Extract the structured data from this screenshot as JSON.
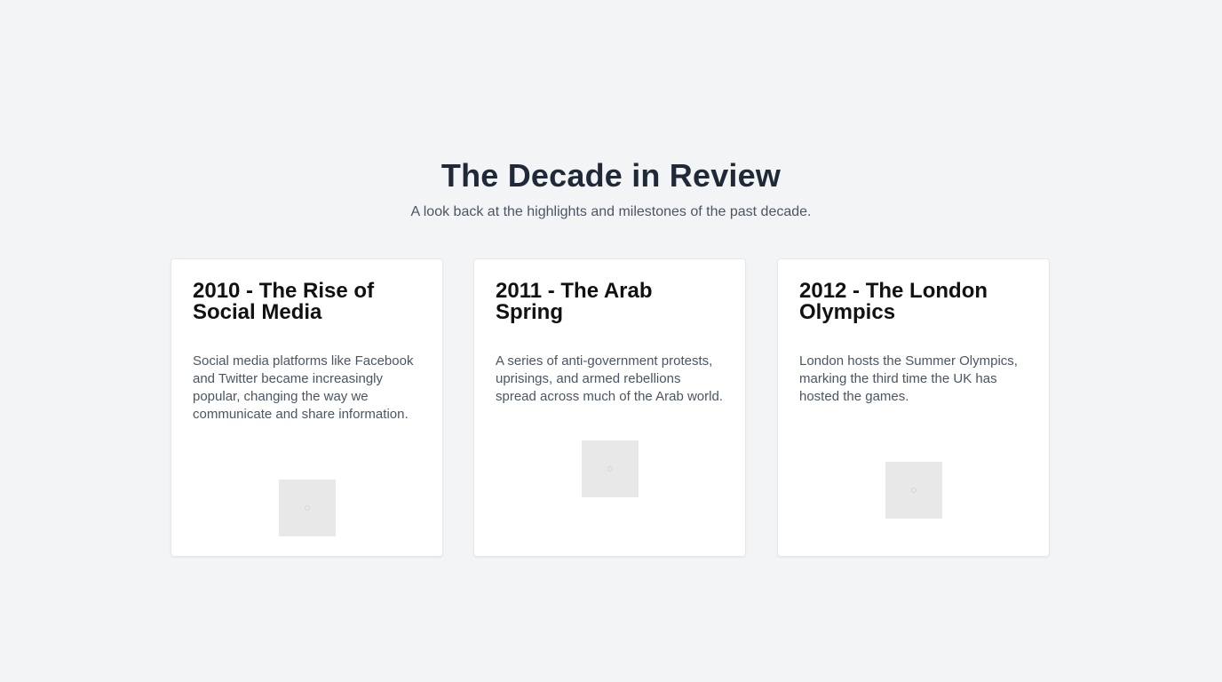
{
  "header": {
    "title": "The Decade in Review",
    "subtitle": "A look back at the highlights and milestones of the past decade."
  },
  "cards": [
    {
      "title": "2010 - The Rise of Social Media",
      "text": "Social media platforms like Facebook and Twitter became increasingly popular, changing the way we communicate and share information."
    },
    {
      "title": "2011 - The Arab Spring",
      "text": "A series of anti-government protests, uprisings, and armed rebellions spread across much of the Arab world."
    },
    {
      "title": "2012 - The London Olympics",
      "text": "London hosts the Summer Olympics, marking the third time the UK has hosted the games."
    }
  ]
}
